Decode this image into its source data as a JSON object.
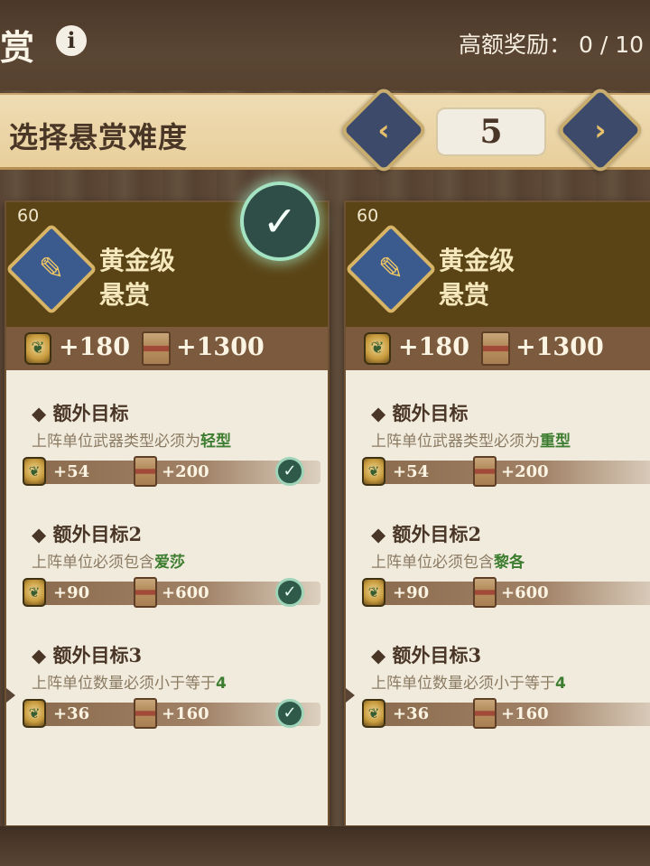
{
  "header": {
    "title": "赏",
    "info_symbol": "i",
    "high_reward_label": "高额奖励：",
    "high_reward_value": "0 / 10"
  },
  "difficulty": {
    "label": "选择悬赏难度",
    "prev_symbol": "‹",
    "next_symbol": "›",
    "value": "5"
  },
  "cards": [
    {
      "level": "60",
      "title_line1": "黄金级",
      "title_line2": "悬赏",
      "badge_icon": "scroll-icon",
      "selected": true,
      "reward_coin": "+180",
      "reward_book": "+1300",
      "objectives": [
        {
          "title": "◆ 额外目标",
          "desc_prefix": "上阵单位武器类型必须为",
          "desc_highlight": "轻型",
          "coin": "+54",
          "book": "+200",
          "completed": true
        },
        {
          "title": "◆ 额外目标2",
          "desc_prefix": "上阵单位必须包含",
          "desc_highlight": "爱莎",
          "coin": "+90",
          "book": "+600",
          "completed": true
        },
        {
          "title": "◆ 额外目标3",
          "desc_prefix": "上阵单位数量必须小于等于",
          "desc_highlight": "4",
          "coin": "+36",
          "book": "+160",
          "completed": true
        }
      ]
    },
    {
      "level": "60",
      "title_line1": "黄金级",
      "title_line2": "悬赏",
      "badge_icon": "scroll-icon",
      "selected": false,
      "reward_coin": "+180",
      "reward_book": "+1300",
      "objectives": [
        {
          "title": "◆ 额外目标",
          "desc_prefix": "上阵单位武器类型必须为",
          "desc_highlight": "重型",
          "coin": "+54",
          "book": "+200",
          "completed": false
        },
        {
          "title": "◆ 额外目标2",
          "desc_prefix": "上阵单位必须包含",
          "desc_highlight": "黎各",
          "coin": "+90",
          "book": "+600",
          "completed": false
        },
        {
          "title": "◆ 额外目标3",
          "desc_prefix": "上阵单位数量必须小于等于",
          "desc_highlight": "4",
          "coin": "+36",
          "book": "+160",
          "completed": false
        }
      ]
    }
  ],
  "check_symbol": "✓",
  "colors": {
    "header_band": "#5a4416",
    "reward_band": "#7c5a3e",
    "highlight_text": "#3c7d2f",
    "arrow_button": "#3d4a6a"
  }
}
